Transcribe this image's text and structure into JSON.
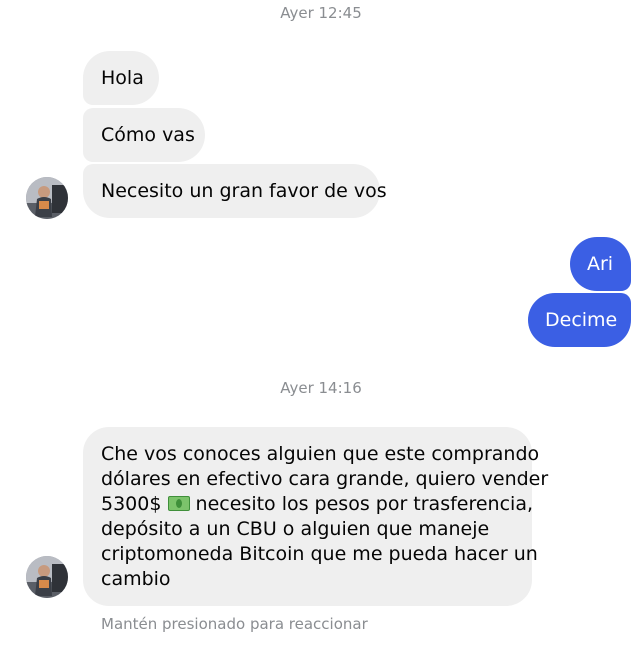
{
  "timestamps": [
    "Ayer 12:45",
    "Ayer 14:16"
  ],
  "incoming_group1": [
    "Hola",
    "Cómo vas",
    "Necesito un gran favor de vos"
  ],
  "outgoing_group": [
    "Ari",
    "Decime"
  ],
  "incoming_long": {
    "line1": "Che vos conoces alguien que este comprando",
    "line2": "dólares en efectivo cara grande, quiero vender",
    "line3a": "5300$",
    "emoji_icon": "dollar-banknote-icon",
    "line3b": "necesito los pesos por trasferencia,",
    "line4": "depósito a un CBU o alguien que maneje",
    "line5": "criptomoneda Bitcoin que me pueda hacer un",
    "line6": "cambio"
  },
  "hint": "Mantén presionado para reaccionar",
  "colors": {
    "incoming_bubble": "#efefef",
    "outgoing_bubble": "#3b5fe4",
    "timestamp_text": "#8a8d91"
  }
}
